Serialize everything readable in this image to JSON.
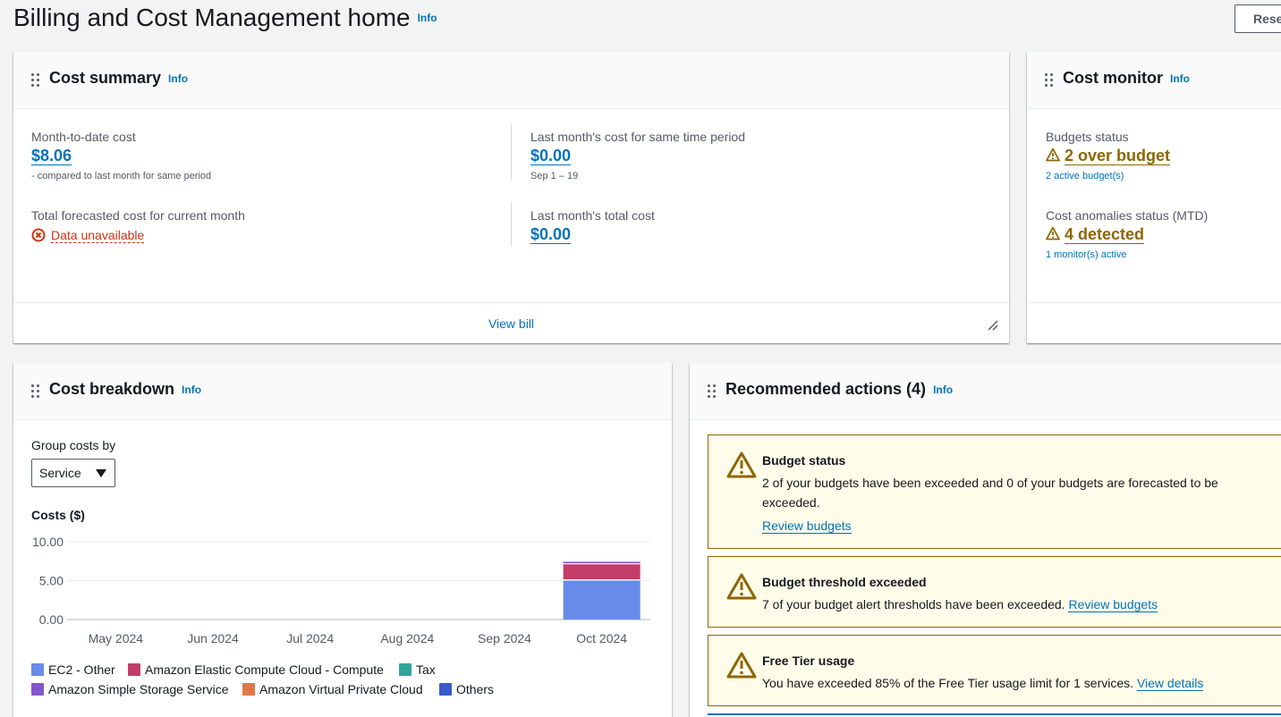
{
  "page": {
    "title": "Billing and Cost Management home",
    "info": "Info",
    "reset_label": "Rese"
  },
  "cost_summary": {
    "title": "Cost summary",
    "info": "Info",
    "mtd_label": "Month-to-date cost",
    "mtd_value": "$8.06",
    "mtd_note": "- compared to last month for same period",
    "last_same_label": "Last month's cost for same time period",
    "last_same_value": "$0.00",
    "last_same_note": "Sep 1 – 19",
    "forecast_label": "Total forecasted cost for current month",
    "forecast_error": "Data unavailable",
    "last_total_label": "Last month's total cost",
    "last_total_value": "$0.00",
    "view_bill": "View bill"
  },
  "cost_monitor": {
    "title": "Cost monitor",
    "info": "Info",
    "budgets_label": "Budgets status",
    "budgets_value": "2 over budget",
    "budgets_note": "2 active budget(s)",
    "anomalies_label": "Cost anomalies status (MTD)",
    "anomalies_value": "4 detected",
    "anomalies_note": "1 monitor(s) active"
  },
  "cost_breakdown": {
    "title": "Cost breakdown",
    "info": "Info",
    "group_label": "Group costs by",
    "group_value": "Service",
    "costs_label": "Costs ($)"
  },
  "chart_data": {
    "type": "bar",
    "stacked": true,
    "ylabel": "Costs ($)",
    "ylim": [
      0,
      10
    ],
    "yticks": [
      "0.00",
      "5.00",
      "10.00"
    ],
    "categories": [
      "May 2024",
      "Jun 2024",
      "Jul 2024",
      "Aug 2024",
      "Sep 2024",
      "Oct 2024"
    ],
    "series": [
      {
        "name": "EC2 - Other",
        "color": "#688ae8",
        "values": [
          0,
          0,
          0,
          0,
          0,
          5.0
        ]
      },
      {
        "name": "Amazon Elastic Compute Cloud - Compute",
        "color": "#c33d69",
        "values": [
          0,
          0,
          0,
          0,
          0,
          2.1
        ]
      },
      {
        "name": "Tax",
        "color": "#2ea597",
        "values": [
          0,
          0,
          0,
          0,
          0,
          0.3
        ]
      },
      {
        "name": "Amazon Simple Storage Service",
        "color": "#8456ce",
        "values": [
          0,
          0,
          0,
          0,
          0,
          0.03
        ]
      },
      {
        "name": "Amazon Virtual Private Cloud",
        "color": "#e07941",
        "values": [
          0,
          0,
          0,
          0,
          0,
          0
        ]
      },
      {
        "name": "Others",
        "color": "#3759ce",
        "values": [
          0,
          0,
          0,
          0,
          0,
          0
        ]
      }
    ],
    "grid": true,
    "legend": "bottom"
  },
  "recommended": {
    "title": "Recommended actions (4)",
    "info": "Info",
    "alerts": [
      {
        "title": "Budget status",
        "body": "2 of your budgets have been exceeded and 0 of your budgets are forecasted to be exceeded.",
        "link": "Review budgets"
      },
      {
        "title": "Budget threshold exceeded",
        "body": "7 of your budget alert thresholds have been exceeded. ",
        "link": "Review budgets"
      },
      {
        "title": "Free Tier usage",
        "body": "You have exceeded 85% of the Free Tier usage limit for 1 services. ",
        "link": "View details"
      }
    ]
  }
}
